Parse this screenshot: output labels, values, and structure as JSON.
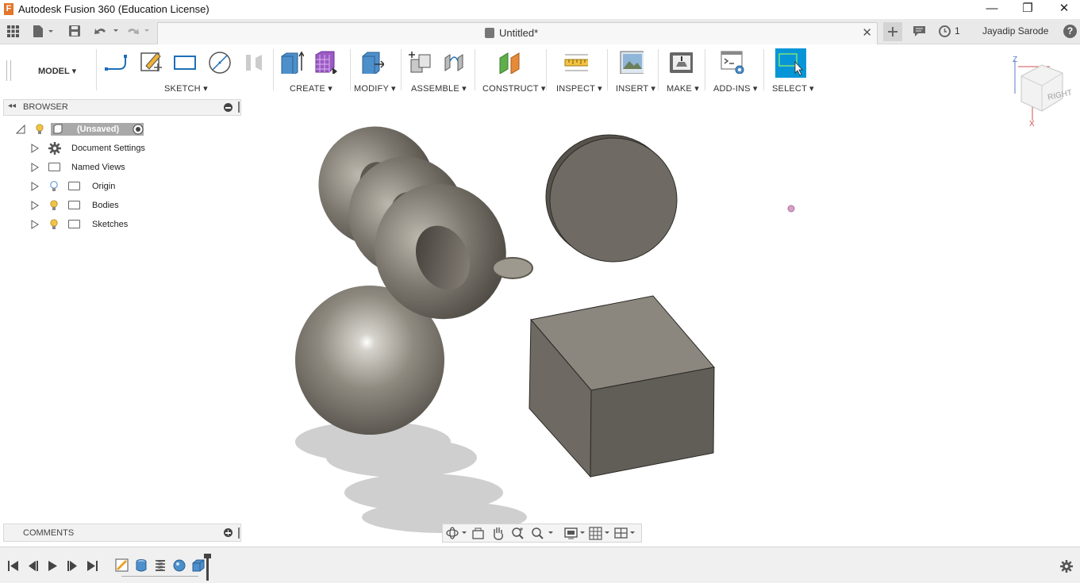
{
  "window": {
    "title": "Autodesk Fusion 360 (Education License)",
    "logo_letter": "F",
    "minimize": "—",
    "restore": "❐",
    "close": "✕"
  },
  "appbar": {
    "document_tab": "Untitled*",
    "notification_count": "1",
    "user_name": "Jayadip Sarode",
    "help": "?"
  },
  "toolbar": {
    "workspace": "MODEL",
    "groups": {
      "sketch": "SKETCH",
      "create": "CREATE",
      "modify": "MODIFY",
      "assemble": "ASSEMBLE",
      "construct": "CONSTRUCT",
      "inspect": "INSPECT",
      "insert": "INSERT",
      "make": "MAKE",
      "addins": "ADD-INS",
      "select": "SELECT"
    }
  },
  "viewcube": {
    "face_label": "RIGHT",
    "axis_z": "Z",
    "axis_x": "X"
  },
  "browser": {
    "title": "BROWSER",
    "root": "(Unsaved)",
    "items": [
      {
        "label": "Document Settings",
        "icon": "gear-icon"
      },
      {
        "label": "Named Views",
        "icon": "folder-icon"
      },
      {
        "label": "Origin",
        "icon": "folder-icon"
      },
      {
        "label": "Bodies",
        "icon": "folder-icon"
      },
      {
        "label": "Sketches",
        "icon": "folder-icon"
      }
    ]
  },
  "comments": {
    "title": "COMMENTS"
  },
  "colors": {
    "select_active": "#0696d7",
    "body_gray": "#6f6b64",
    "shadow": "#cfcfcf",
    "logo": "#e2762b"
  }
}
